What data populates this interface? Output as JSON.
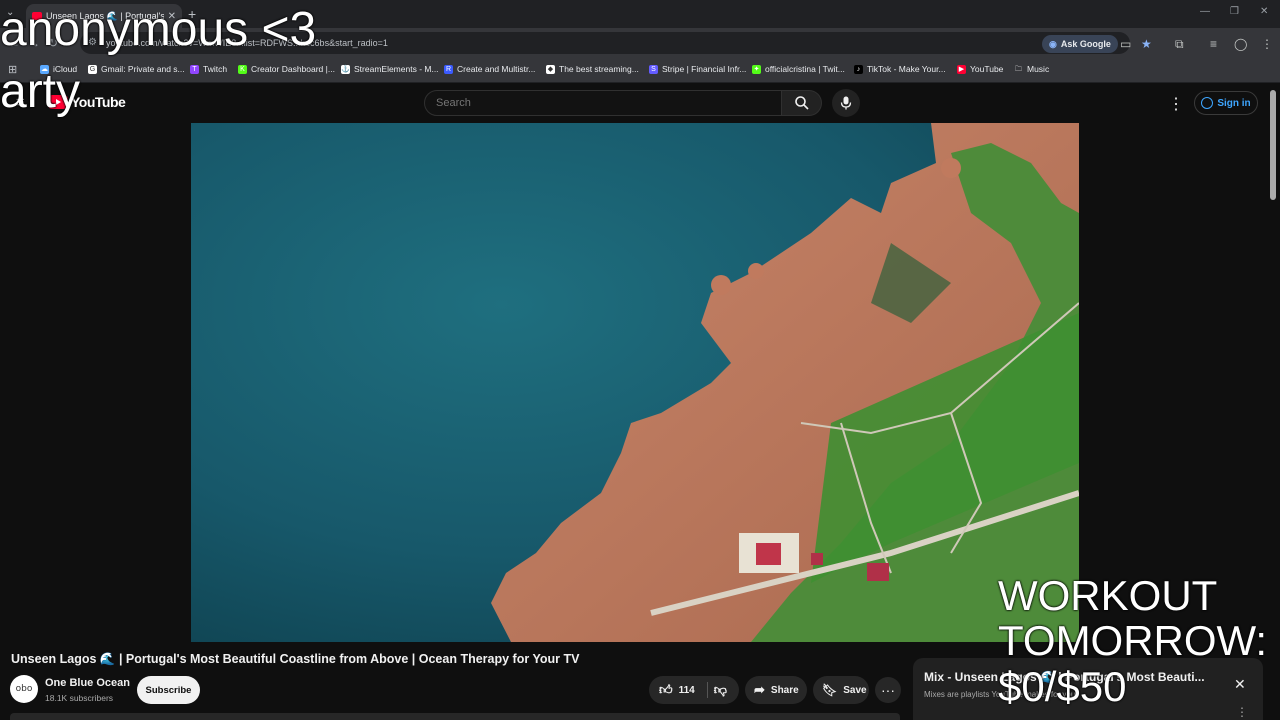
{
  "browser": {
    "tab": {
      "title": "Unseen Lagos 🌊 | Portugal's B",
      "close": "✕"
    },
    "new_tab": "+",
    "tab_search": "⌄",
    "window_controls": [
      "—",
      "❐",
      "✕"
    ],
    "nav": {
      "back": "←",
      "forward": "→",
      "reload": "↻",
      "info": "⚙"
    },
    "url": "youtube.com/watch?v=WmWIE8...list=RDFWS...hcc6bs&start_radio=1",
    "ask_google": "Ask Google",
    "toolbar_icons": [
      "cast-icon",
      "star-icon",
      "extensions-icon",
      "media-icon",
      "profile-icon",
      "menu-icon"
    ],
    "bookmarks": [
      {
        "label": "iCloud",
        "color": "#5aa9ff",
        "glyph": "☁"
      },
      {
        "label": "Gmail: Private and s...",
        "color": "#ffffff",
        "glyph": "G"
      },
      {
        "label": "Twitch",
        "color": "#9146ff",
        "glyph": "T"
      },
      {
        "label": "Creator Dashboard |...",
        "color": "#53fc18",
        "glyph": "K"
      },
      {
        "label": "StreamElements - M...",
        "color": "#ffffff",
        "glyph": "⚓"
      },
      {
        "label": "Create and Multistr...",
        "color": "#3b5bff",
        "glyph": "R"
      },
      {
        "label": "The best streaming...",
        "color": "#ffffff",
        "glyph": "◆"
      },
      {
        "label": "Stripe | Financial Infr...",
        "color": "#635bff",
        "glyph": "S"
      },
      {
        "label": "officialcristina | Twit...",
        "color": "#53fc18",
        "glyph": "✦"
      },
      {
        "label": "TikTok - Make Your...",
        "color": "#000000",
        "glyph": "♪"
      },
      {
        "label": "YouTube",
        "color": "#ff0033",
        "glyph": "▶"
      },
      {
        "label": "Music",
        "color": "#35363a",
        "glyph": "🗀"
      }
    ]
  },
  "youtube": {
    "logo_text": "YouTube",
    "search_placeholder": "Search",
    "sign_in": "Sign in",
    "more_menu": "⋮"
  },
  "video": {
    "title": "Unseen Lagos 🌊 | Portugal's Most Beautiful Coastline from Above | Ocean Therapy for Your TV",
    "channel": "One Blue Ocean",
    "avatar_text": "obo",
    "subscribers": "18.1K subscribers",
    "subscribe": "Subscribe",
    "likes": "114",
    "share": "Share",
    "save": "Save",
    "more": "···"
  },
  "mix": {
    "title": "Mix - Unseen Lagos 🌊 | Portugal's Most Beauti...",
    "subtitle": "Mixes are playlists YouTube makes for you",
    "close": "✕",
    "more": "⋮"
  },
  "overlays": {
    "top_line1": "anonymous <3",
    "top_line2": "arty",
    "goal_line1": "WORKOUT",
    "goal_line2": "TOMORROW:",
    "goal_line3": "$0/$50"
  }
}
